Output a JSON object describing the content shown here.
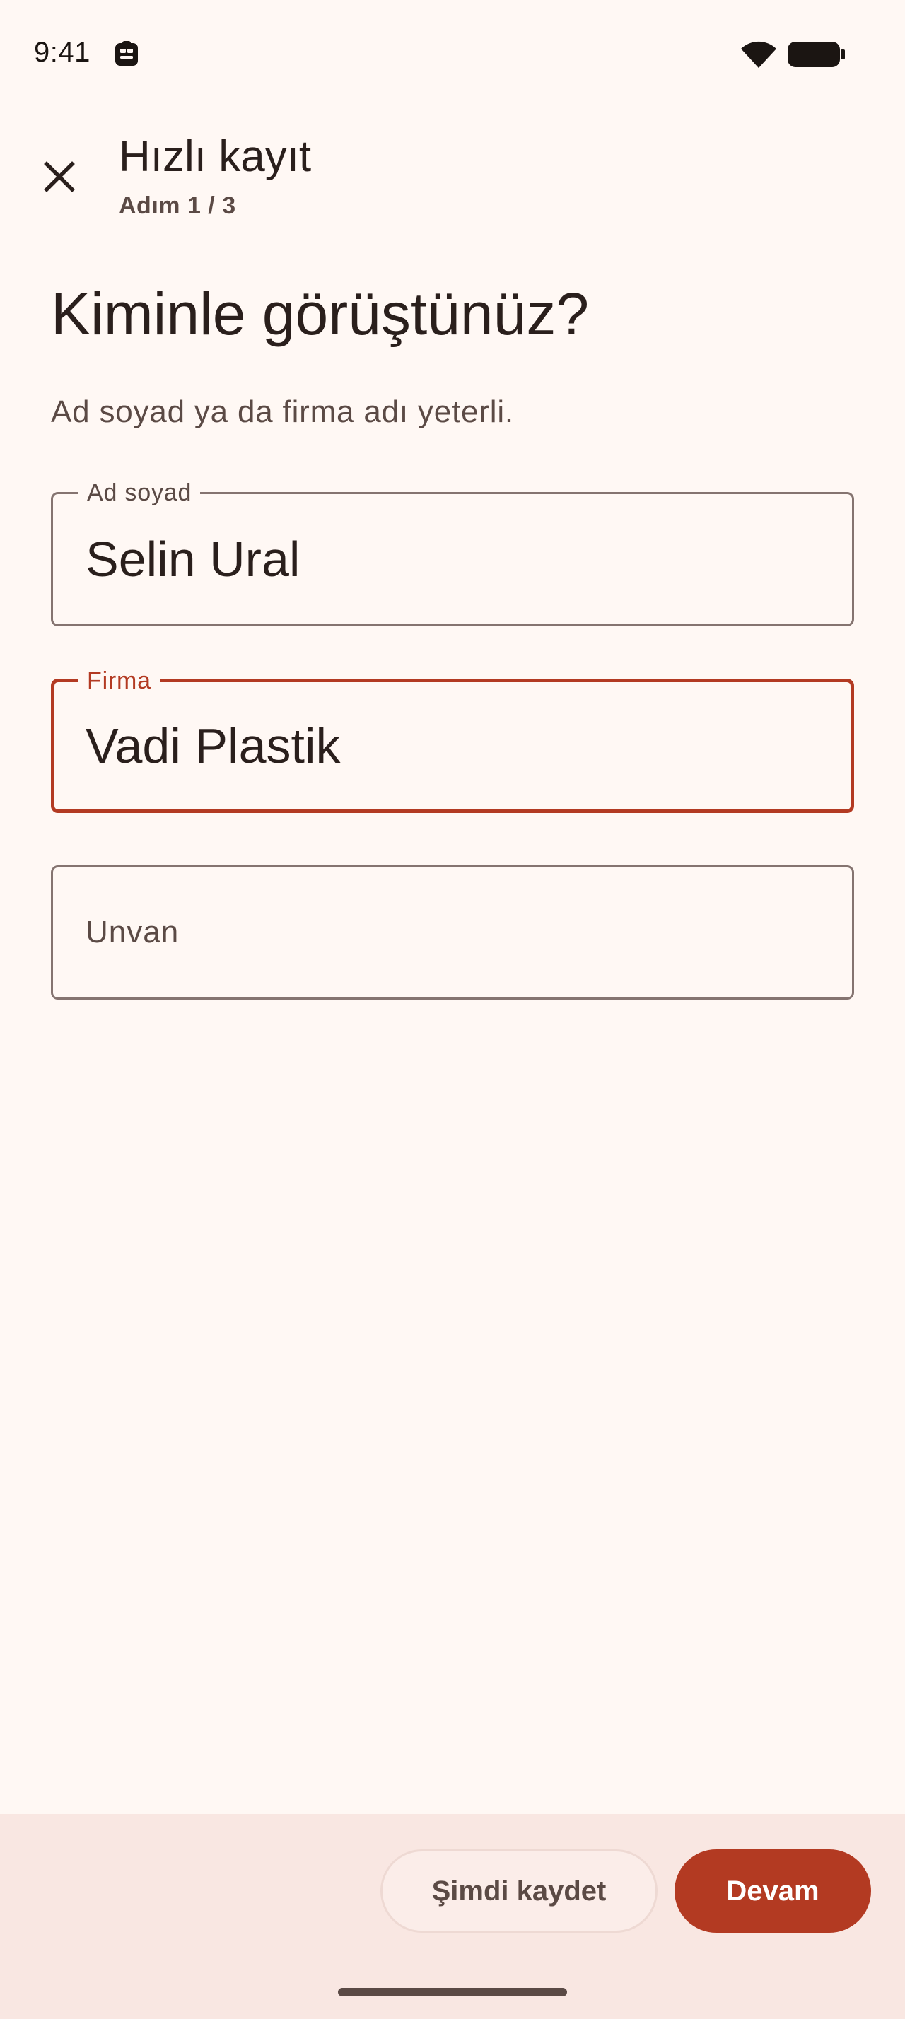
{
  "status_bar": {
    "time": "9:41",
    "icons": [
      "app-notification-icon",
      "wifi-icon",
      "battery-icon"
    ]
  },
  "app_bar": {
    "close_icon": "close-icon",
    "title": "Hızlı kayıt",
    "subtitle": "Adım 1 / 3"
  },
  "main": {
    "heading": "Kiminle görüştünüz?",
    "helper_text": "Ad soyad ya da firma adı yeterli.",
    "fields": [
      {
        "label": "Ad soyad",
        "value": "Selin Ural",
        "placeholder": "",
        "focused": false
      },
      {
        "label": "Firma",
        "value": "Vadi Plastik",
        "placeholder": "",
        "focused": true
      },
      {
        "label": "",
        "value": "",
        "placeholder": "Unvan",
        "focused": false
      }
    ]
  },
  "actions": {
    "save_now_label": "Şimdi kaydet",
    "continue_label": "Devam"
  },
  "colors": {
    "background": "#FFF8F4",
    "accent": "#B33A22",
    "bottom_bar": "#F9E7E2",
    "outline": "#857470",
    "text_primary": "#2A1F1C",
    "text_secondary": "#5B4A45"
  }
}
